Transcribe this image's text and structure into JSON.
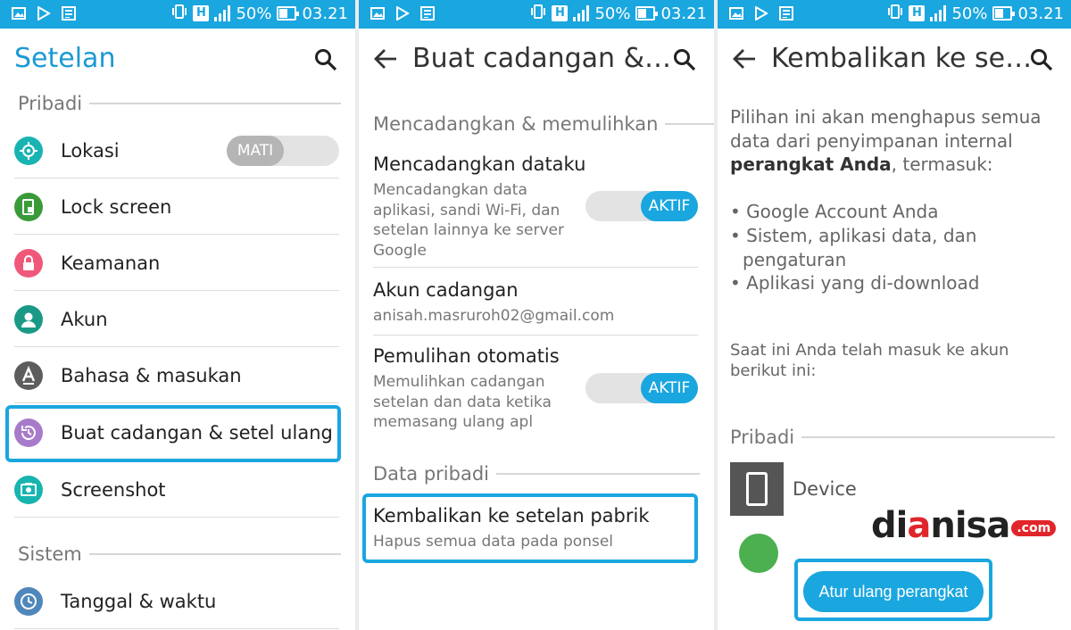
{
  "statusbar": {
    "signal_mode": "H",
    "battery": "50%",
    "time": "03.21"
  },
  "screen1": {
    "title": "Setelan",
    "section_personal": "Pribadi",
    "items": [
      {
        "label": "Lokasi",
        "toggle": "MATI"
      },
      {
        "label": "Lock screen"
      },
      {
        "label": "Keamanan"
      },
      {
        "label": "Akun"
      },
      {
        "label": "Bahasa & masukan"
      },
      {
        "label": "Buat cadangan & setel ulang"
      },
      {
        "label": "Screenshot"
      }
    ],
    "section_system": "Sistem",
    "system_items": [
      {
        "label": "Tanggal & waktu"
      }
    ]
  },
  "screen2": {
    "title": "Buat cadangan &…",
    "section_backup": "Mencadangkan & memulihkan",
    "backup_data": {
      "title": "Mencadangkan dataku",
      "desc": "Mencadangkan data aplikasi, sandi Wi-Fi, dan setelan lainnya ke server Google",
      "toggle": "AKTIF"
    },
    "backup_account": {
      "title": "Akun cadangan",
      "value": "anisah.masruroh02@gmail.com"
    },
    "auto_restore": {
      "title": "Pemulihan otomatis",
      "desc": "Memulihkan cadangan setelan dan data ketika memasang ulang apl",
      "toggle": "AKTIF"
    },
    "section_personal": "Data pribadi",
    "factory_reset": {
      "title": "Kembalikan ke setelan pabrik",
      "desc": "Hapus semua data pada ponsel"
    }
  },
  "screen3": {
    "title": "Kembalikan ke se…",
    "intro_pre": "Pilihan ini akan menghapus semua data dari penyimpanan internal",
    "intro_bold": "perangkat Anda",
    "intro_post": ", termasuk:",
    "bullets": [
      "• Google Account Anda",
      "• Sistem, aplikasi data, dan",
      "pengaturan",
      "• Aplikasi yang di-download"
    ],
    "account_notice": "Saat ini Anda telah masuk ke akun berikut ini:",
    "section_personal": "Pribadi",
    "device_label": "Device",
    "reset_button": "Atur ulang perangkat"
  },
  "watermark": {
    "part1": "di",
    "part2": "a",
    "part3": "nisa",
    "domain": ".com"
  },
  "colors": {
    "accent": "#1aa6df",
    "title_blue": "#1a9ad3",
    "watermark_red": "#e0262b"
  }
}
